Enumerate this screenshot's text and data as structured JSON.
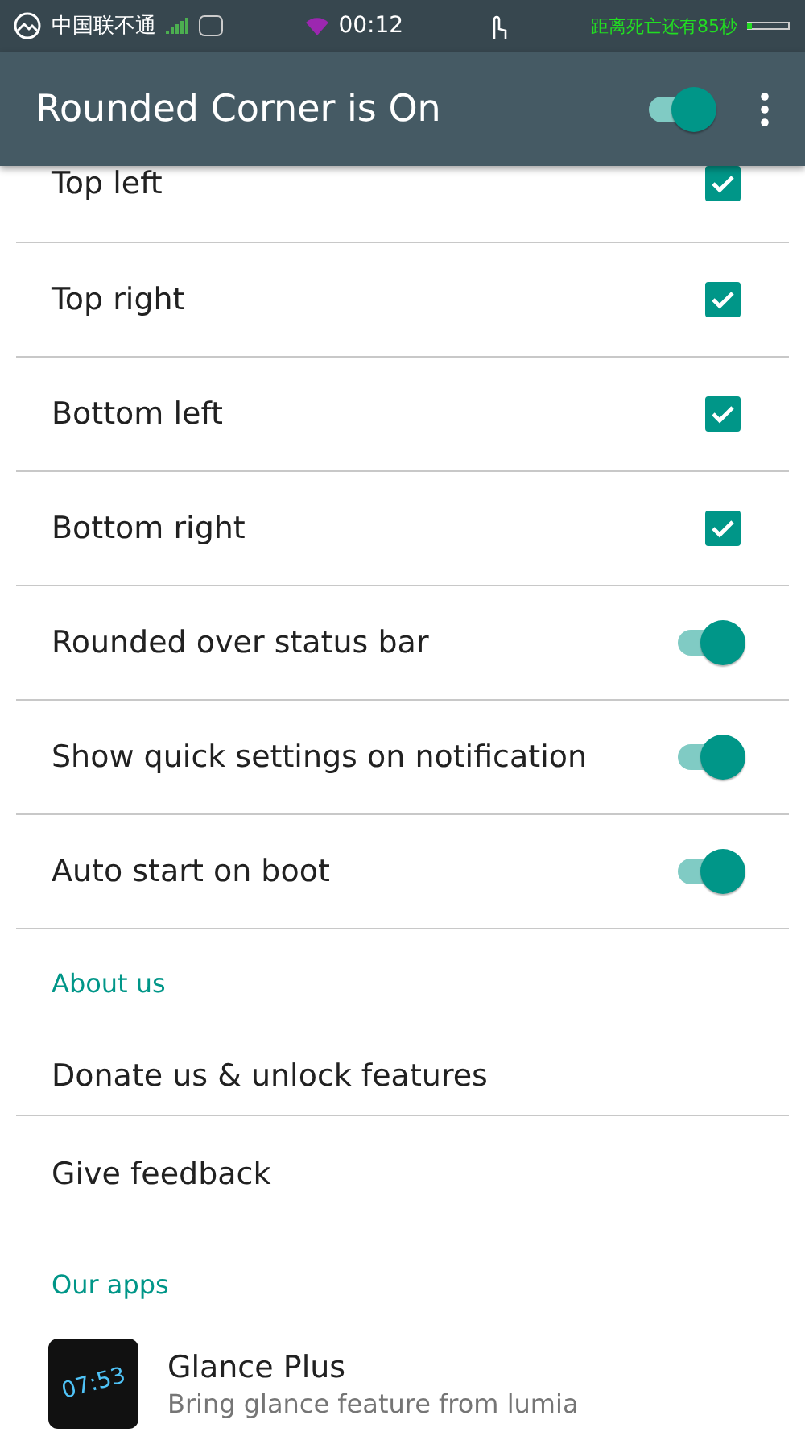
{
  "status_bar": {
    "carrier": "中国联不通",
    "time": "00:12",
    "notice": "距离死亡还有85秒"
  },
  "toolbar": {
    "title": "Rounded Corner is On",
    "master_on": true
  },
  "settings": [
    {
      "label": "Top left",
      "kind": "checkbox",
      "checked": true
    },
    {
      "label": "Top right",
      "kind": "checkbox",
      "checked": true
    },
    {
      "label": "Bottom left",
      "kind": "checkbox",
      "checked": true
    },
    {
      "label": "Bottom right",
      "kind": "checkbox",
      "checked": true
    },
    {
      "label": "Rounded over status bar",
      "kind": "switch",
      "on": true
    },
    {
      "label": "Show quick settings on notification",
      "kind": "switch",
      "on": true
    },
    {
      "label": "Auto start on boot",
      "kind": "switch",
      "on": true
    }
  ],
  "about": {
    "header": "About us",
    "items": [
      "Donate us & unlock features",
      "Give feedback"
    ]
  },
  "apps": {
    "header": "Our apps",
    "items": [
      {
        "icon_text": "07:53",
        "name": "Glance Plus",
        "description": "Bring glance feature from lumia"
      }
    ]
  }
}
